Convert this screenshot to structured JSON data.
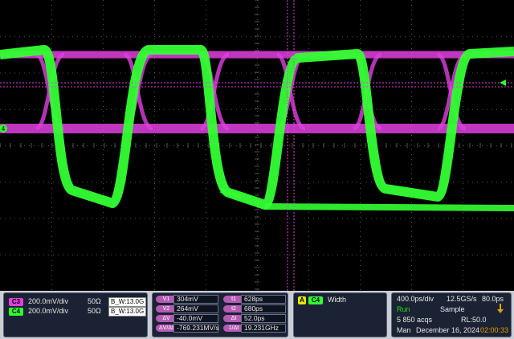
{
  "colors": {
    "ch3": "#e040e0",
    "ch4": "#33ff33",
    "grid": "#555555",
    "run": "#22dd22",
    "time": "#e6a100"
  },
  "channels": [
    {
      "badge": "C3",
      "scale": "200.0mV/div",
      "impedance": "50Ω",
      "bw": "13.0G",
      "bw_prefix": "B_W:"
    },
    {
      "badge": "C4",
      "scale": "200.0mV/div",
      "impedance": "50Ω",
      "bw": "13.0G",
      "bw_prefix": "B_W:"
    }
  ],
  "cursors": [
    {
      "label": "V1",
      "value": "304mV"
    },
    {
      "label": "V2",
      "value": "264mV"
    },
    {
      "label": "ΔV",
      "value": "-40.0mV"
    },
    {
      "label": "ΔV/Δt",
      "value": "-769.231MV/s"
    }
  ],
  "time_cursors": [
    {
      "label": "t1",
      "value": "628ps"
    },
    {
      "label": "t2",
      "value": "680ps"
    },
    {
      "label": "Δt",
      "value": "52.0ps"
    },
    {
      "label": "1/Δt",
      "value": "19.231GHz"
    }
  ],
  "measurement": {
    "badge_a": "A",
    "badge_ch": "C4",
    "label": "Width"
  },
  "acquisition": {
    "timebase": "400.0ps/div",
    "sample_rate": "12.5GS/s",
    "resolution": "80.0ps",
    "state": "Run",
    "mode": "Sample",
    "acqs": "5 850 acqs",
    "record_length": "RL:50.0",
    "trigger_mode": "Man",
    "date": "December 16, 2024",
    "time": "02:00:33"
  },
  "markers": {
    "ch4_ref": "4"
  }
}
